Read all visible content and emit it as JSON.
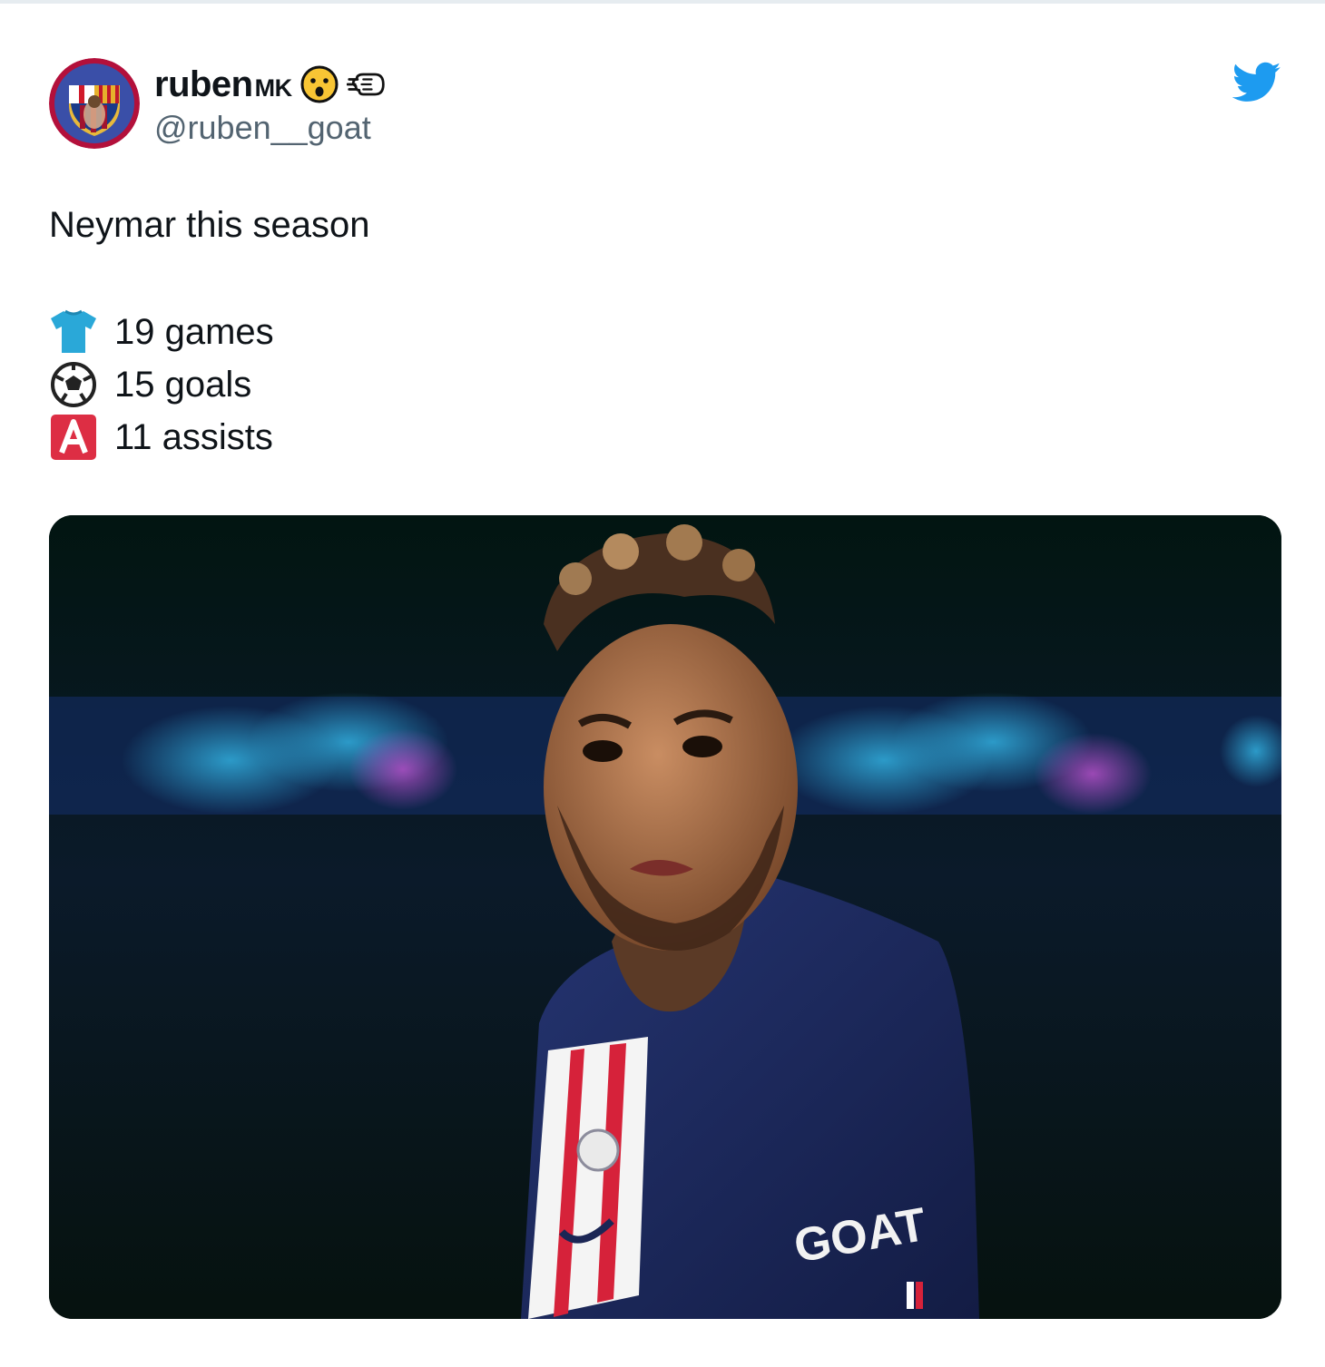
{
  "tweet": {
    "author": {
      "display_name": "ruben",
      "display_name_suffix": "MK",
      "emojis": [
        "hushed-face-emoji",
        "right-fist-emoji"
      ],
      "handle": "@ruben__goat",
      "avatar_icon": "fc-barcelona-crest-avatar"
    },
    "platform_icon": "twitter-bird-icon",
    "text": "Neymar this season",
    "stats": [
      {
        "icon": "shirt-icon",
        "label": "19 games"
      },
      {
        "icon": "soccer-ball-icon",
        "label": "15 goals"
      },
      {
        "icon": "letter-a-icon",
        "label": "11 assists"
      }
    ],
    "media": {
      "description_icon": "player-photo",
      "shirt_text": "GOAT"
    }
  },
  "colors": {
    "twitter_blue": "#1d9bf0",
    "handle_gray": "#536471",
    "shirt_navy": "#1b2655",
    "psg_red": "#d6223a"
  }
}
